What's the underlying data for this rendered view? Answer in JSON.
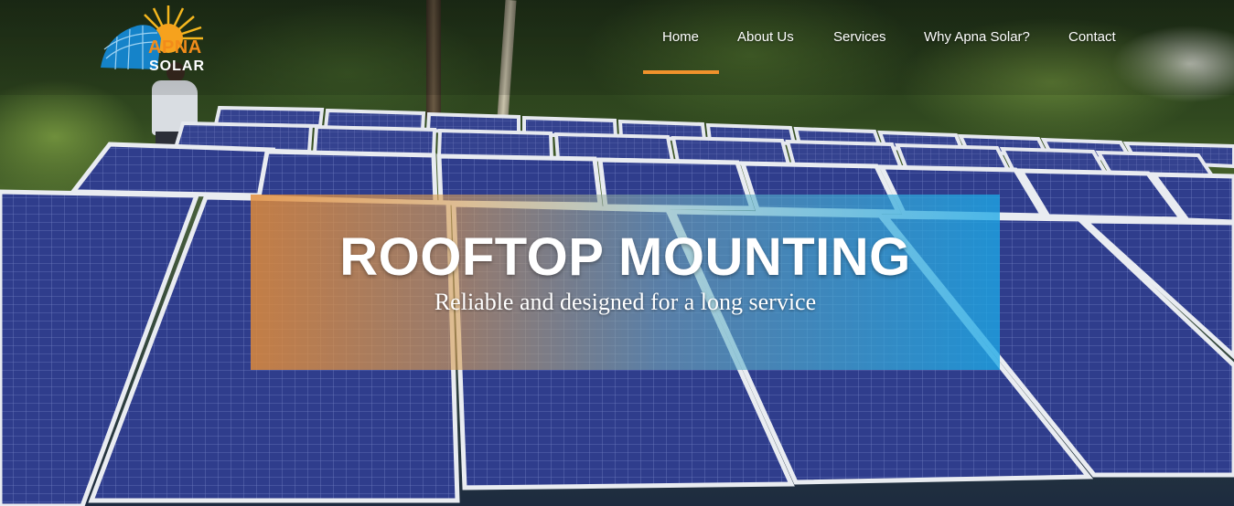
{
  "brand": {
    "logo_line1": "APNA",
    "logo_line2": "SOLAR",
    "accent_orange": "#f28c1a",
    "accent_blue": "#1f8ed6"
  },
  "nav": {
    "items": [
      {
        "label": "Home",
        "active": true
      },
      {
        "label": "About Us",
        "active": false
      },
      {
        "label": "Services",
        "active": false
      },
      {
        "label": "Why Apna Solar?",
        "active": false
      },
      {
        "label": "Contact",
        "active": false
      }
    ],
    "active_indicator_color": "#f0922c"
  },
  "hero": {
    "title": "ROOFTOP MOUNTING",
    "subtitle": "Reliable and designed for a long service",
    "background": "solar panel array photo"
  }
}
